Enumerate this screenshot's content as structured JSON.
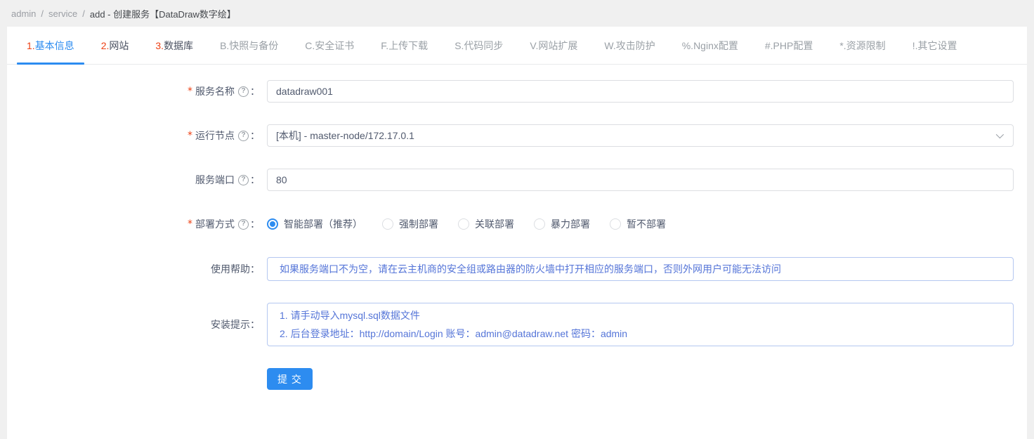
{
  "breadcrumb": {
    "items": [
      "admin",
      "service"
    ],
    "separator": "/",
    "current": "add  -  创建服务【DataDraw数字绘】"
  },
  "tabs": [
    {
      "prefix": "1.",
      "label": "基本信息",
      "prefix_red": true,
      "active": true
    },
    {
      "prefix": "2.",
      "label": "网站",
      "prefix_red": true,
      "active": false
    },
    {
      "prefix": "3.",
      "label": "数据库",
      "prefix_red": true,
      "active": false
    },
    {
      "prefix": "B.",
      "label": "快照与备份",
      "prefix_red": false,
      "active": false
    },
    {
      "prefix": "C.",
      "label": "安全证书",
      "prefix_red": false,
      "active": false
    },
    {
      "prefix": "F.",
      "label": "上传下载",
      "prefix_red": false,
      "active": false
    },
    {
      "prefix": "S.",
      "label": "代码同步",
      "prefix_red": false,
      "active": false
    },
    {
      "prefix": "V.",
      "label": "网站扩展",
      "prefix_red": false,
      "active": false
    },
    {
      "prefix": "W.",
      "label": "攻击防护",
      "prefix_red": false,
      "active": false
    },
    {
      "prefix": "%.",
      "label": "Nginx配置",
      "prefix_red": false,
      "active": false
    },
    {
      "prefix": "#.",
      "label": "PHP配置",
      "prefix_red": false,
      "active": false
    },
    {
      "prefix": "*.",
      "label": "资源限制",
      "prefix_red": false,
      "active": false
    },
    {
      "prefix": "!.",
      "label": "其它设置",
      "prefix_red": false,
      "active": false
    }
  ],
  "form": {
    "required_mark": "*",
    "help_icon_glyph": "?",
    "colon": "：",
    "service_name": {
      "label": "服务名称",
      "value": "datadraw001"
    },
    "run_node": {
      "label": "运行节点",
      "value": "[本机] - master-node/172.17.0.1"
    },
    "service_port": {
      "label": "服务端口",
      "value": "80"
    },
    "deploy_mode": {
      "label": "部署方式",
      "options": [
        {
          "label": "智能部署（推荐）",
          "selected": true
        },
        {
          "label": "强制部署",
          "selected": false
        },
        {
          "label": "关联部署",
          "selected": false
        },
        {
          "label": "暴力部署",
          "selected": false
        },
        {
          "label": "暂不部署",
          "selected": false
        }
      ]
    },
    "usage_help": {
      "label": "使用帮助",
      "text": "如果服务端口不为空，请在云主机商的安全组或路由器的防火墙中打开相应的服务端口，否则外网用户可能无法访问"
    },
    "install_tips": {
      "label": "安装提示",
      "lines": [
        "1. 请手动导入mysql.sql数据文件",
        "2. 后台登录地址：http://domain/Login 账号：admin@datadraw.net 密码：admin"
      ]
    },
    "submit_label": "提 交"
  },
  "colors": {
    "primary": "#2d8cf0",
    "danger_red": "#ed4014",
    "info_text_blue": "#5575d8",
    "info_border_blue": "#b4c7f0",
    "page_bg": "#f0f0f0"
  }
}
